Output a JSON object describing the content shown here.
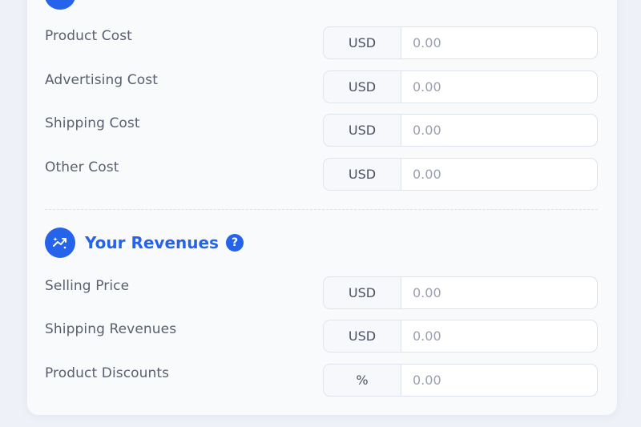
{
  "costs": {
    "rows": [
      {
        "label": "Product Cost",
        "unit": "USD",
        "placeholder": "0.00"
      },
      {
        "label": "Advertising Cost",
        "unit": "USD",
        "placeholder": "0.00"
      },
      {
        "label": "Shipping Cost",
        "unit": "USD",
        "placeholder": "0.00"
      },
      {
        "label": "Other Cost",
        "unit": "USD",
        "placeholder": "0.00"
      }
    ]
  },
  "revenues": {
    "title": "Your Revenues",
    "help_glyph": "?",
    "icon": "trend-sparkle-icon",
    "rows": [
      {
        "label": "Selling Price",
        "unit": "USD",
        "placeholder": "0.00"
      },
      {
        "label": "Shipping Revenues",
        "unit": "USD",
        "placeholder": "0.00"
      },
      {
        "label": "Product Discounts",
        "unit": "%",
        "placeholder": "0.00"
      }
    ]
  },
  "colors": {
    "accent": "#2563eb",
    "label": "#5a6070",
    "placeholder": "#9aa0ad",
    "card": "#f9fafc",
    "background": "#eef1f7"
  }
}
